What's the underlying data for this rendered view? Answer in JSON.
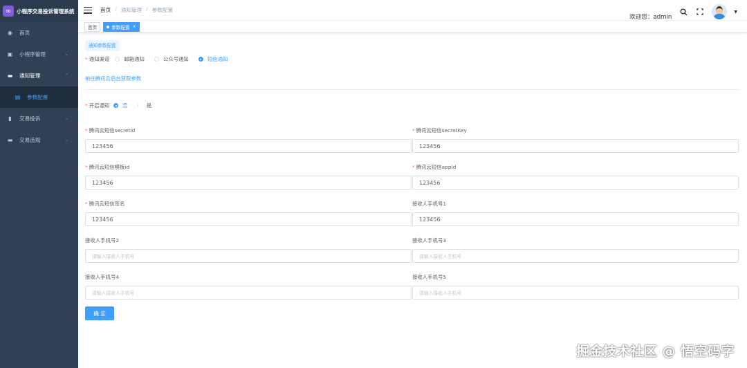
{
  "app": {
    "title": "小程序交易投诉管理系统"
  },
  "sidebar": {
    "items": [
      {
        "label": "首页"
      },
      {
        "label": "小程序管理"
      },
      {
        "label": "通知管理"
      },
      {
        "label": "参数配置"
      },
      {
        "label": "交易投诉"
      },
      {
        "label": "交易违规"
      }
    ]
  },
  "header": {
    "breadcrumb": [
      "首页",
      "通知管理",
      "参数配置"
    ],
    "welcome": "欢迎您：admin"
  },
  "tags": {
    "home": "首页",
    "active": "参数配置"
  },
  "form": {
    "section_tab": "通知参数配置",
    "channel_label": "通知渠道",
    "channels": [
      "邮箱通知",
      "公众号通知",
      "短信通知"
    ],
    "selected_channel": "短信通知",
    "link_text": "前往腾讯云后台获取参数",
    "enable_label": "开启通知",
    "enable_options": [
      "否",
      "是"
    ],
    "selected_enable": "否",
    "fields": {
      "secretid_label": "腾讯云短信secretId",
      "secretid_value": "123456",
      "secretkey_label": "腾讯云短信secretKey",
      "secretkey_value": "123456",
      "templateid_label": "腾讯云短信模板id",
      "templateid_value": "123456",
      "appid_label": "腾讯云短信appid",
      "appid_value": "123456",
      "sign_label": "腾讯云短信签名",
      "sign_value": "123456",
      "phone1_label": "接收人手机号1",
      "phone1_value": "123456",
      "phone2_label": "接收人手机号2",
      "phone3_label": "接收人手机号3",
      "phone4_label": "接收人手机号4",
      "phone5_label": "接收人手机号5",
      "phone_placeholder": "请输入接收人手机号"
    },
    "confirm_label": "确 定"
  },
  "watermark": "掘金技术社区 @ 悟空码字",
  "colors": {
    "sidebar_bg": "#304156",
    "accent": "#409eff",
    "required": "#f56c6c"
  }
}
